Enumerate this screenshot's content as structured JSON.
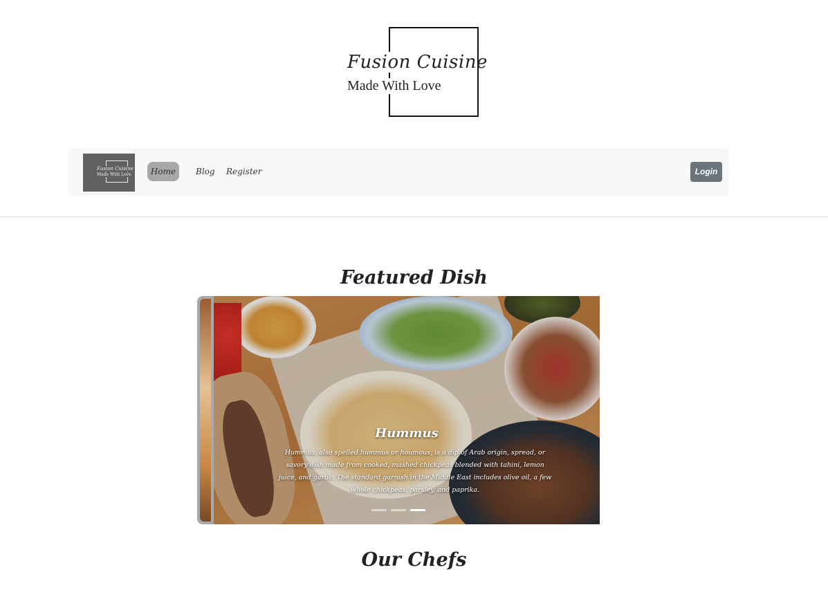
{
  "brand": {
    "script_name": "Fusion Cuisine",
    "tagline": "Made With Love"
  },
  "nav": {
    "logo_script": "Fusion Cuisine",
    "logo_tagline": "Made With Love",
    "items": [
      {
        "label": "Home",
        "active": true
      },
      {
        "label": "Blog",
        "active": false
      },
      {
        "label": "Register",
        "active": false
      }
    ],
    "login_label": "Login"
  },
  "featured": {
    "title": "Featured Dish",
    "slide": {
      "title": "Hummus",
      "description": "Hummus, also spelled hummus or houmous, is a dip of Arab origin, spread, or savory dish made from cooked, mashed chickpeas blended with tahini, lemon juice, and garlic. The standard garnish in the Middle East includes olive oil, a few whole chickpeas, parsley, and paprika."
    },
    "indicators": {
      "count": 3,
      "active_index": 2
    }
  },
  "chefs": {
    "title": "Our Chefs"
  },
  "colors": {
    "navbar_bg": "#f7f8f9",
    "active_pill": "#a8a8a8",
    "login_bg": "#6b737b",
    "nav_logo_bg": "#616161"
  }
}
